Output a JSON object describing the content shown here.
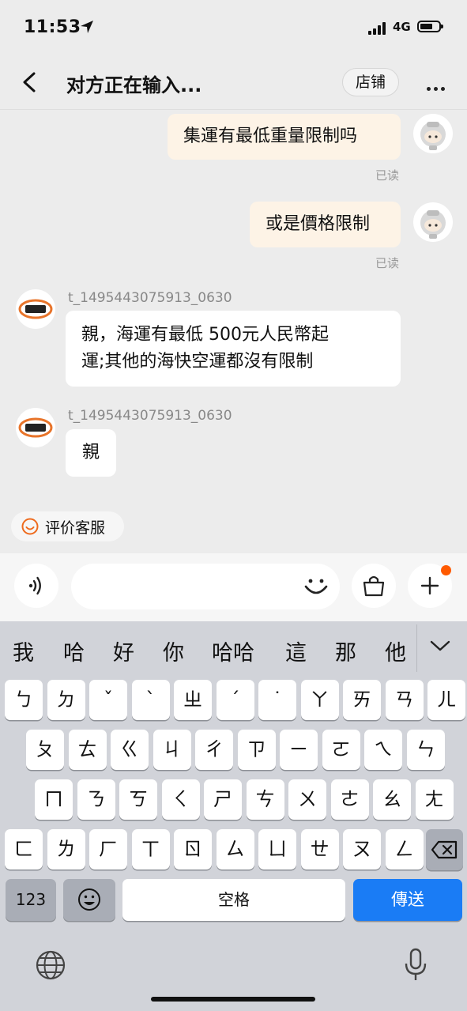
{
  "status_bar": {
    "time": "11:53",
    "network": "4G"
  },
  "nav": {
    "title": "对方正在输入...",
    "shop_label": "店铺"
  },
  "messages": {
    "m1": {
      "text": "集運有最低重量限制吗",
      "status": "已读"
    },
    "m2": {
      "text": "或是價格限制",
      "status": "已读"
    },
    "m3": {
      "sender": "t_1495443075913_0630",
      "line1": "親，海運有最低 500元人民幣起",
      "line2": "運;其他的海快空運都沒有限制"
    },
    "m4": {
      "sender": "t_1495443075913_0630",
      "text": "親"
    }
  },
  "rate_button": {
    "label": "评价客服",
    "icon": "smile-icon"
  },
  "input_bar": {
    "icons": [
      "voice-icon",
      "emoji-icon",
      "bag-icon",
      "plus-icon"
    ],
    "accent": "#ff5a00"
  },
  "keyboard": {
    "candidates": [
      "我",
      "哈",
      "好",
      "你",
      "哈哈",
      "這",
      "那",
      "他"
    ],
    "rows": [
      [
        "ㄅ",
        "ㄉ",
        "ˇ",
        "ˋ",
        "ㄓ",
        "ˊ",
        "˙",
        "ㄚ",
        "ㄞ",
        "ㄢ",
        "ㄦ"
      ],
      [
        "ㄆ",
        "ㄊ",
        "ㄍ",
        "ㄐ",
        "ㄔ",
        "ㄗ",
        "ㄧ",
        "ㄛ",
        "ㄟ",
        "ㄣ"
      ],
      [
        "ㄇ",
        "ㄋ",
        "ㄎ",
        "ㄑ",
        "ㄕ",
        "ㄘ",
        "ㄨ",
        "ㄜ",
        "ㄠ",
        "ㄤ"
      ],
      [
        "ㄈ",
        "ㄌ",
        "ㄏ",
        "ㄒ",
        "ㄖ",
        "ㄙ",
        "ㄩ",
        "ㄝ",
        "ㄡ",
        "ㄥ"
      ]
    ],
    "num_label": "123",
    "space_label": "空格",
    "send_label": "傳送",
    "send_color": "#1a7cf5"
  }
}
